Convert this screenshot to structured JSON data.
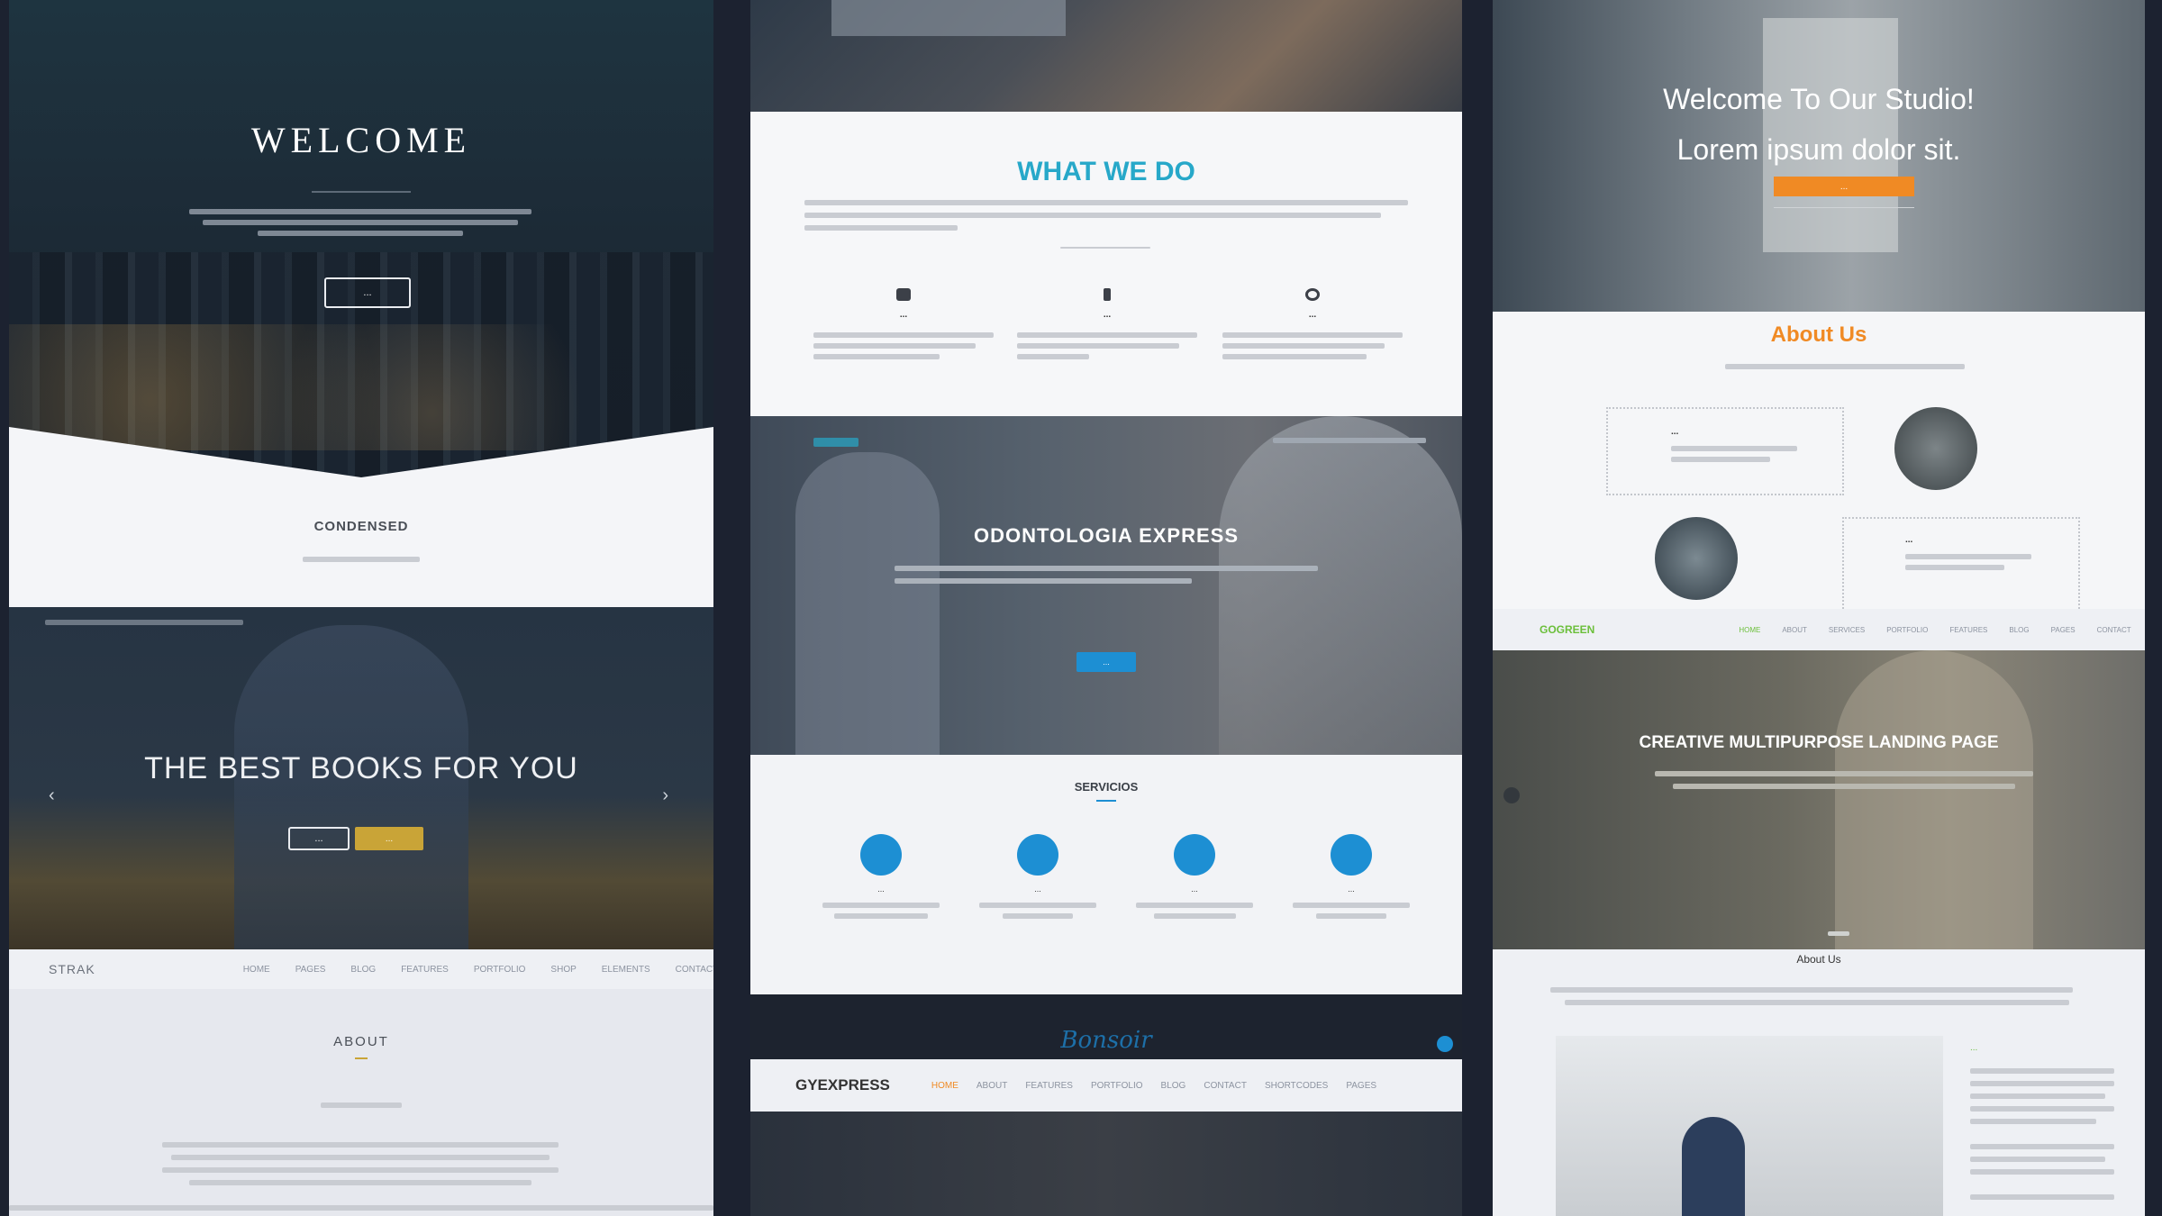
{
  "col1": {
    "hero": {
      "title": "WELCOME",
      "button": "..."
    },
    "section2": {
      "title": "CONDENSED"
    },
    "books": {
      "title": "THE BEST BOOKS FOR YOU",
      "btn_primary": "...",
      "btn_secondary": "..."
    },
    "nav": {
      "logo": "STRAK",
      "items": [
        "HOME",
        "PAGES",
        "BLOG",
        "FEATURES",
        "PORTFOLIO",
        "SHOP",
        "ELEMENTS",
        "CONTACT"
      ]
    },
    "about": {
      "title": "ABOUT"
    }
  },
  "col2": {
    "what_we_do": {
      "title": "WHAT WE DO",
      "features": [
        "...",
        "...",
        "..."
      ]
    },
    "dental": {
      "title": "ODONTOLOGIA EXPRESS",
      "button": "..."
    },
    "services": {
      "title": "SERVICIOS",
      "items": [
        "...",
        "...",
        "...",
        "..."
      ]
    },
    "bottom_nav": {
      "logo": "GYEXPRESS",
      "script_logo": "Bonsoir",
      "items": [
        "HOME",
        "ABOUT",
        "FEATURES",
        "PORTFOLIO",
        "BLOG",
        "CONTACT",
        "SHORTCODES",
        "PAGES"
      ]
    }
  },
  "col3": {
    "studio": {
      "title_line1": "Welcome To Our Studio!",
      "title_line2": "Lorem ipsum dolor sit.",
      "button": "..."
    },
    "about_us": {
      "title": "About Us",
      "subtitle": "...",
      "card1_title": "...",
      "card2_title": "..."
    },
    "nav": {
      "logo": "GOGREEN",
      "items": [
        "HOME",
        "ABOUT",
        "SERVICES",
        "PORTFOLIO",
        "FEATURES",
        "BLOG",
        "PAGES",
        "CONTACT"
      ]
    },
    "creative": {
      "title": "CREATIVE MULTIPURPOSE LANDING PAGE"
    },
    "about_small": {
      "title": "About Us",
      "side_title": "..."
    }
  },
  "colors": {
    "teal": "#27a8c9",
    "orange": "#f08a24",
    "blue": "#1d8fd3",
    "green": "#6bbf3a",
    "gold": "#c9a437"
  }
}
